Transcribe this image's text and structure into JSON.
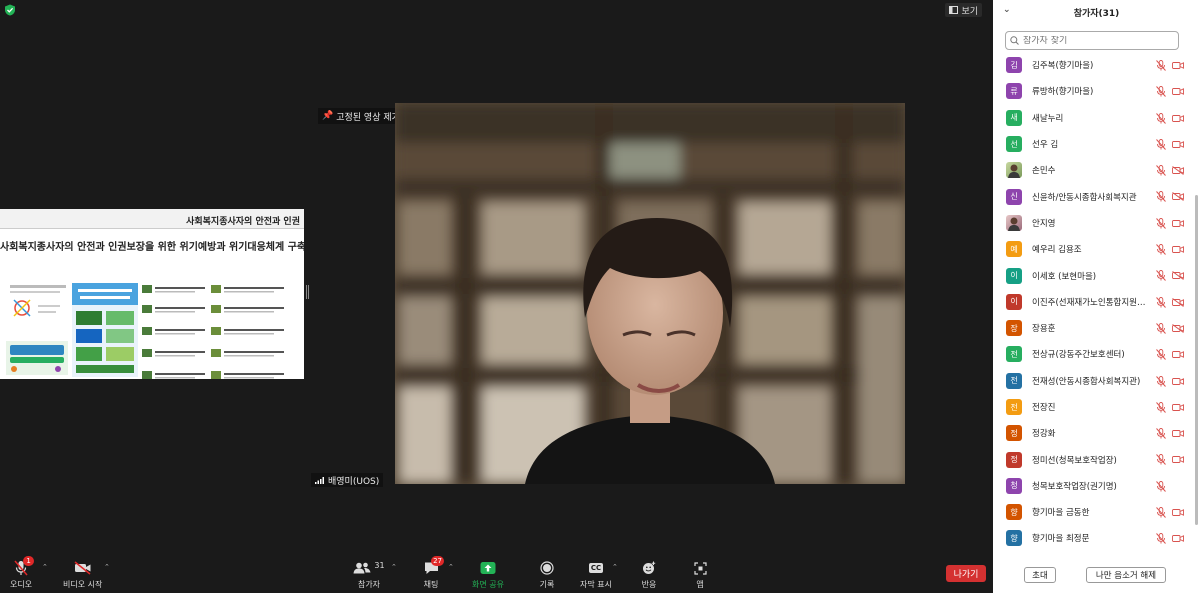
{
  "view_button": "보기",
  "pin_label": "고정된 영상 제거",
  "speaker_name": "배영미(UOS)",
  "share": {
    "header": "사회복지종사자의 안전과 인권",
    "title": "사회복지종사자의 안전과 인권보장을 위한 위기예방과 위기대응체계 구축"
  },
  "toolbar": {
    "audio": "오디오",
    "audio_badge": "1",
    "video": "비디오 시작",
    "participants": "참가자",
    "participants_count": "31",
    "chat": "채팅",
    "chat_badge": "27",
    "share": "화면 공유",
    "record": "기록",
    "caption": "자막 표시",
    "caption_icon": "CC",
    "reactions": "반응",
    "apps": "앱",
    "leave": "나가기"
  },
  "panel": {
    "title": "참가자(31)",
    "search_placeholder": "참가자 찾기",
    "invite": "초대",
    "unmute_self": "나만 음소거 해제",
    "participants": [
      {
        "initial": "김",
        "name": "김주복(향기마을)",
        "color": "#8e44ad",
        "mic": "muted",
        "cam": "off"
      },
      {
        "initial": "류",
        "name": "류방하(향기마을)",
        "color": "#8e44ad",
        "mic": "muted",
        "cam": "off"
      },
      {
        "initial": "새",
        "name": "새날누리",
        "color": "#27ae60",
        "mic": "muted",
        "cam": "off"
      },
      {
        "initial": "선",
        "name": "선우 김",
        "color": "#27ae60",
        "mic": "muted",
        "cam": "off"
      },
      {
        "initial": "",
        "name": "손민수",
        "color": "photo",
        "mic": "muted",
        "cam": "disabled"
      },
      {
        "initial": "신",
        "name": "신윤하/안동시종합사회복지관",
        "color": "#8e44ad",
        "mic": "muted",
        "cam": "disabled"
      },
      {
        "initial": "",
        "name": "안지영",
        "color": "photo2",
        "mic": "muted",
        "cam": "off"
      },
      {
        "initial": "예",
        "name": "예우리 김용조",
        "color": "#f39c12",
        "mic": "muted",
        "cam": "off"
      },
      {
        "initial": "이",
        "name": "이세호 (보현마을)",
        "color": "#16a085",
        "mic": "muted",
        "cam": "disabled"
      },
      {
        "initial": "이",
        "name": "이진주(선재재가노인통합지원센터)",
        "color": "#c0392b",
        "mic": "muted",
        "cam": "disabled"
      },
      {
        "initial": "장",
        "name": "장용훈",
        "color": "#d35400",
        "mic": "muted",
        "cam": "disabled"
      },
      {
        "initial": "전",
        "name": "전상규(강동주간보호센터)",
        "color": "#27ae60",
        "mic": "muted",
        "cam": "off"
      },
      {
        "initial": "전",
        "name": "전재성(안동시종합사회복지관)",
        "color": "#2471a3",
        "mic": "muted",
        "cam": "off"
      },
      {
        "initial": "전",
        "name": "전장진",
        "color": "#f39c12",
        "mic": "muted",
        "cam": "off"
      },
      {
        "initial": "정",
        "name": "정강화",
        "color": "#d35400",
        "mic": "muted",
        "cam": "off"
      },
      {
        "initial": "정",
        "name": "정미선(청목보호작업장)",
        "color": "#c0392b",
        "mic": "muted",
        "cam": "off"
      },
      {
        "initial": "청",
        "name": "청목보호작업장(권기명)",
        "color": "#8e44ad",
        "mic": "muted",
        "cam": "none"
      },
      {
        "initial": "향",
        "name": "향기마을 금동한",
        "color": "#d35400",
        "mic": "muted",
        "cam": "off"
      },
      {
        "initial": "향",
        "name": "향기마을 최정문",
        "color": "#2471a3",
        "mic": "muted",
        "cam": "off"
      }
    ]
  }
}
